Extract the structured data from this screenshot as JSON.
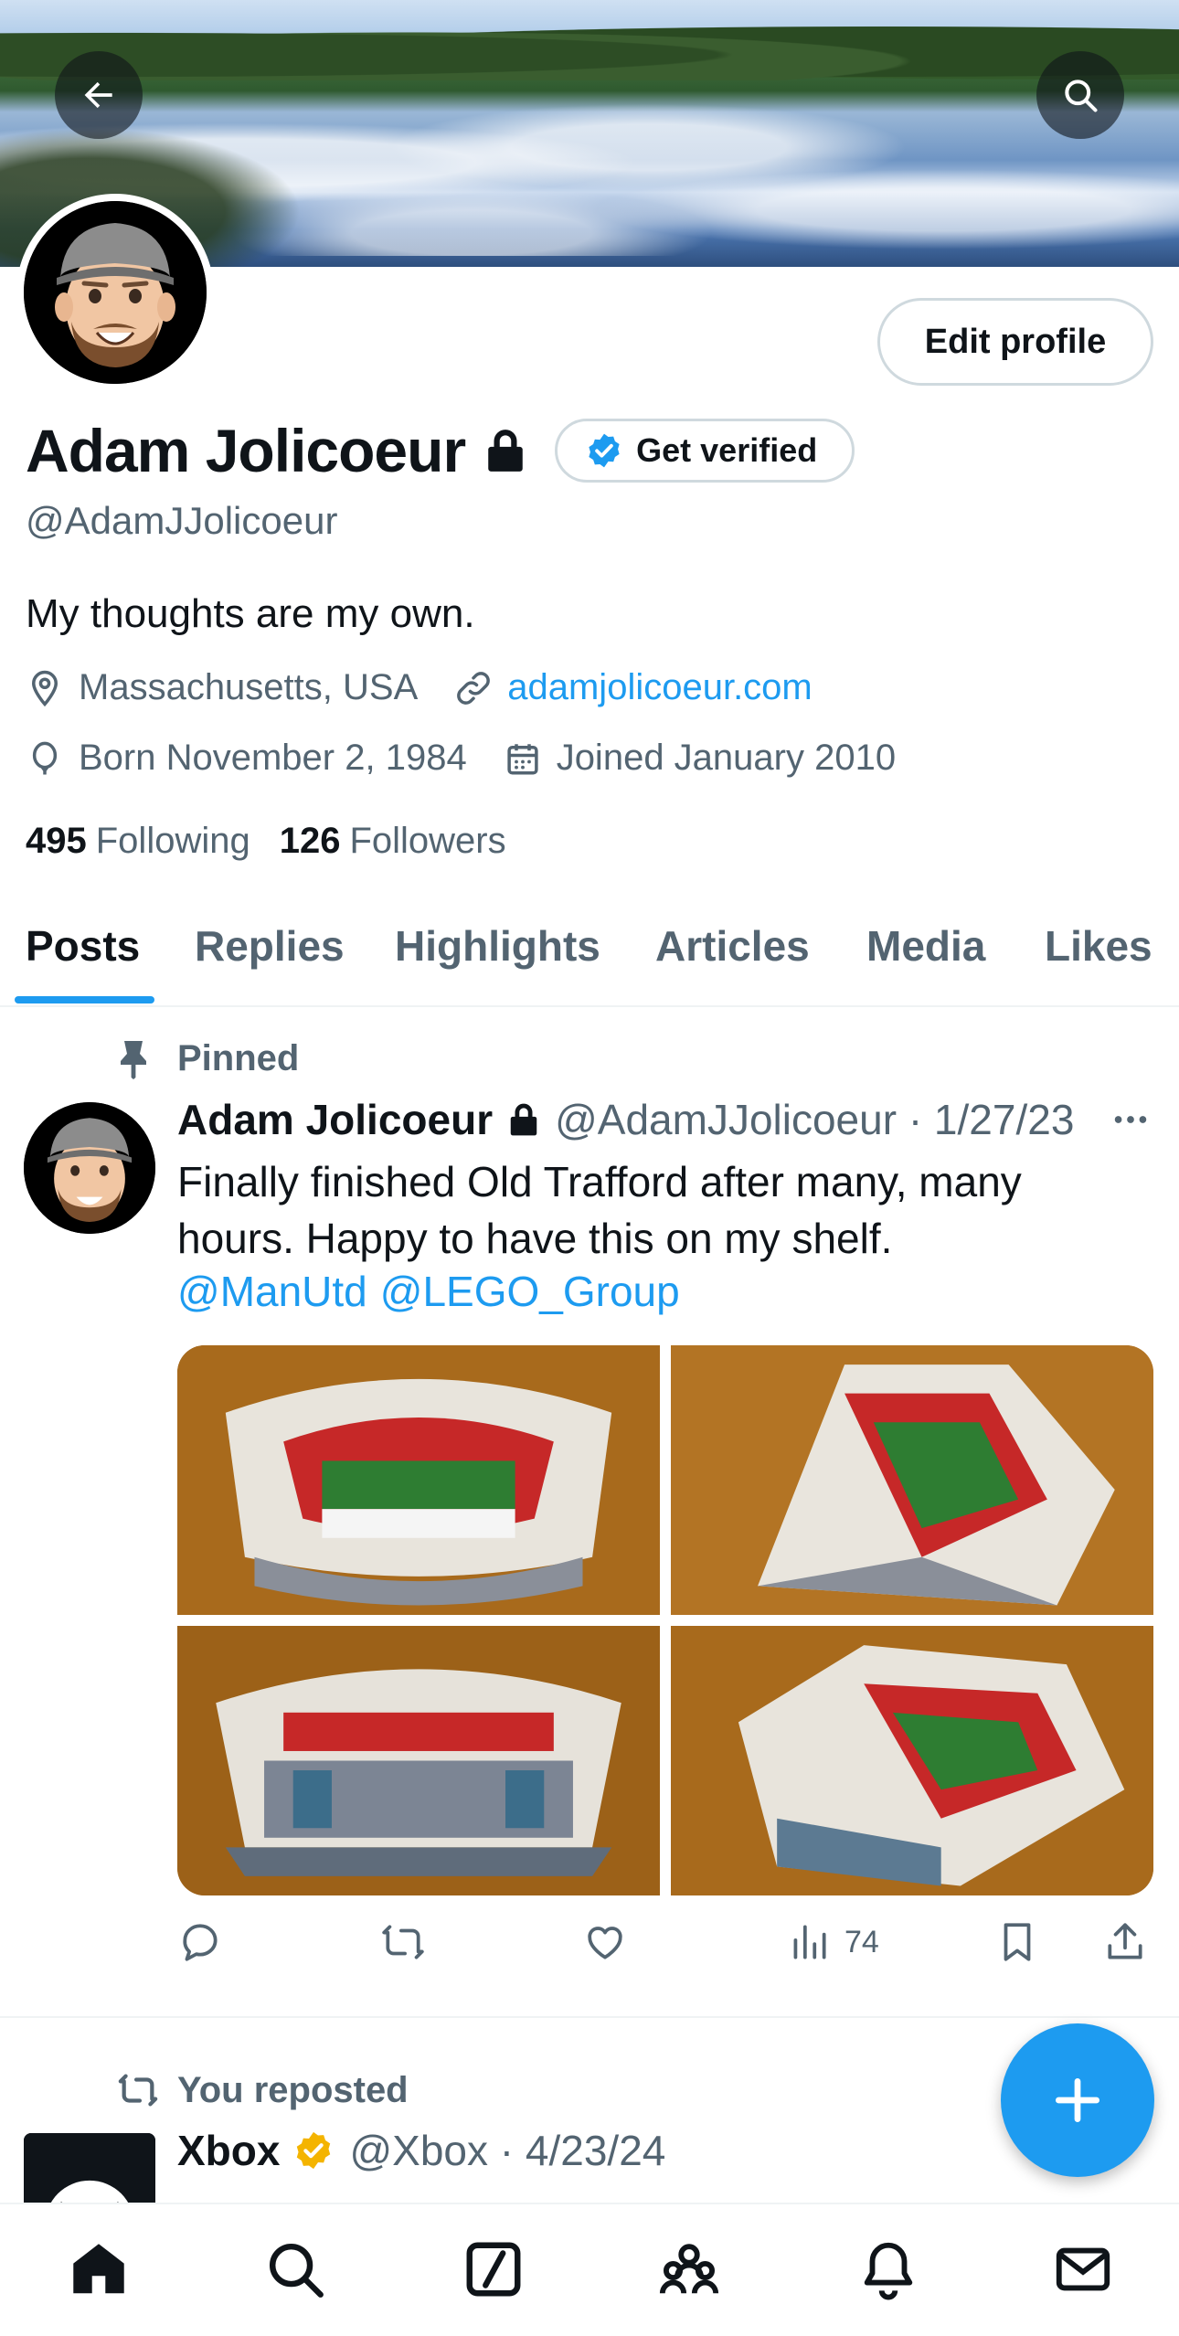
{
  "header": {
    "back_icon": "arrow-left-icon",
    "search_icon": "search-icon"
  },
  "profile": {
    "name": "Adam Jolicoeur",
    "handle": "@AdamJJolicoeur",
    "bio": "My thoughts are my own.",
    "edit_label": "Edit profile",
    "get_verified_label": "Get verified",
    "location": "Massachusetts, USA",
    "website": "adamjolicoeur.com",
    "born": "Born November 2, 1984",
    "joined": "Joined January 2010",
    "following_count": "495",
    "following_label": "Following",
    "followers_count": "126",
    "followers_label": "Followers"
  },
  "tabs": [
    {
      "label": "Posts",
      "active": true
    },
    {
      "label": "Replies"
    },
    {
      "label": "Highlights"
    },
    {
      "label": "Articles"
    },
    {
      "label": "Media"
    },
    {
      "label": "Likes"
    }
  ],
  "pinned_post": {
    "pinned_label": "Pinned",
    "author": "Adam Jolicoeur",
    "handle_date": "@AdamJJolicoeur · 1/27/23",
    "text": "Finally finished Old Trafford after many, many hours. Happy to have this on my shelf.",
    "mentions": [
      "@ManUtd",
      "@LEGO_Group"
    ],
    "views": "74"
  },
  "second_post": {
    "repost_label": "You reposted",
    "author": "Xbox",
    "handle_date": "@Xbox · 4/23/24"
  },
  "colors": {
    "accent": "#1d9bf0",
    "text": "#0f1419",
    "secondary": "#536471",
    "border": "#cfd9de",
    "verified_gold": "#f4b400"
  },
  "bottom_nav": [
    "home-icon",
    "search-icon",
    "grok-icon",
    "communities-icon",
    "notifications-icon",
    "messages-icon"
  ]
}
